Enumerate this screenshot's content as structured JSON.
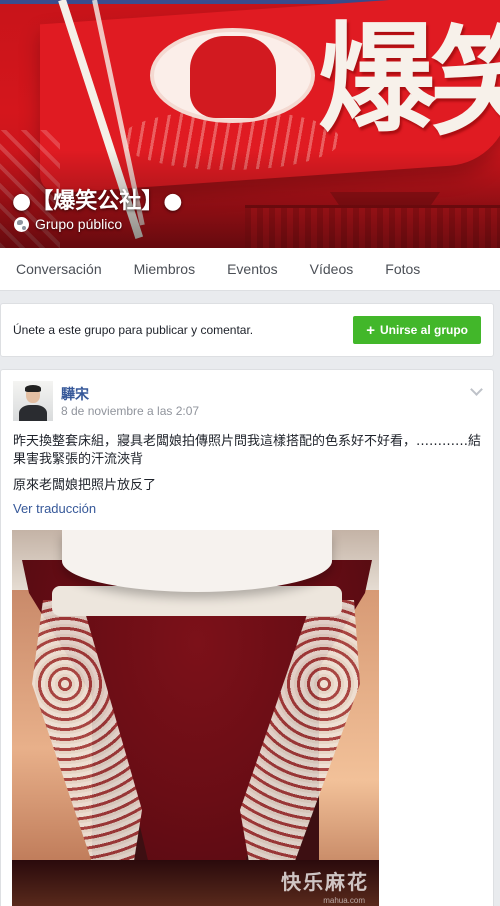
{
  "group": {
    "name": "●【爆笑公社】●",
    "privacy": "Grupo público",
    "cover_text": [
      "爆",
      "笑"
    ]
  },
  "tabs": [
    {
      "label": "Conversación"
    },
    {
      "label": "Miembros"
    },
    {
      "label": "Eventos"
    },
    {
      "label": "Vídeos"
    },
    {
      "label": "Fotos"
    }
  ],
  "join": {
    "prompt": "Únete a este grupo para publicar y comentar.",
    "button_label": "Unirse al grupo",
    "button_icon": "+"
  },
  "post": {
    "author": "驊宋",
    "timestamp": "8 de noviembre a las 2:07",
    "text_lines": [
      "昨天換整套床組，寢具老闆娘拍傳照片問我這樣搭配的色系好不好看，…………結果害我緊張的汗流浹背",
      "原來老闆娘把照片放反了"
    ],
    "translate_label": "Ver traducción",
    "photo_watermark": "快乐麻花",
    "photo_watermark_sub": "mahua.com"
  },
  "colors": {
    "link": "#365899",
    "join_button": "#42b72a",
    "cover_red": "#d4161c"
  }
}
